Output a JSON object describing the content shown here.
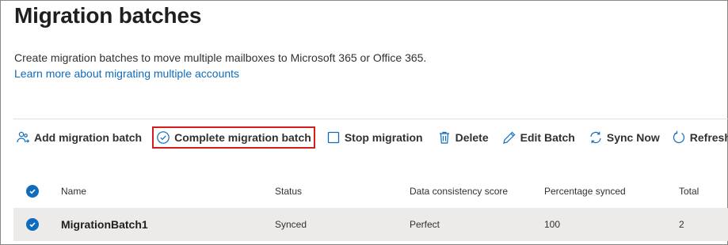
{
  "page": {
    "title": "Migration batches",
    "description": "Create migration batches to move multiple mailboxes to Microsoft 365 or Office 365.",
    "learn_more": "Learn more about migrating multiple accounts"
  },
  "toolbar": {
    "add": {
      "label": "Add migration batch",
      "icon": "add-people-icon"
    },
    "complete": {
      "label": "Complete migration batch",
      "icon": "check-circle-icon"
    },
    "stop": {
      "label": "Stop migration",
      "icon": "stop-icon"
    },
    "delete": {
      "label": "Delete",
      "icon": "trash-icon"
    },
    "edit": {
      "label": "Edit Batch",
      "icon": "pencil-icon"
    },
    "sync": {
      "label": "Sync Now",
      "icon": "sync-icon"
    },
    "refresh": {
      "label": "Refresh",
      "icon": "refresh-icon"
    }
  },
  "table": {
    "columns": [
      "Name",
      "Status",
      "Data consistency score",
      "Percentage synced",
      "Total"
    ],
    "rows": [
      {
        "name": "MigrationBatch1",
        "status": "Synced",
        "score": "Perfect",
        "percent": "100",
        "total": "2",
        "selected": true
      }
    ]
  },
  "colors": {
    "accent": "#0f6cbd",
    "highlight_box": "#d41e1e",
    "selected_row": "#edebe9"
  }
}
